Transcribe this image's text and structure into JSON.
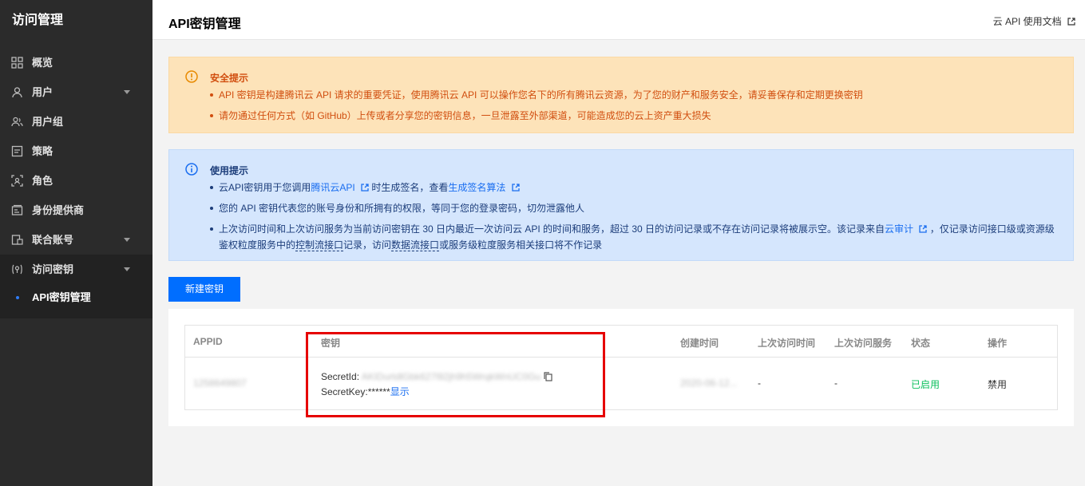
{
  "sidebar": {
    "title": "访问管理",
    "items": [
      {
        "label": "概览",
        "icon": "grid-icon"
      },
      {
        "label": "用户",
        "icon": "user-icon"
      },
      {
        "label": "用户组",
        "icon": "user-group-icon"
      },
      {
        "label": "策略",
        "icon": "policy-icon"
      },
      {
        "label": "角色",
        "icon": "role-icon"
      },
      {
        "label": "身份提供商",
        "icon": "idp-icon"
      },
      {
        "label": "联合账号",
        "icon": "federation-icon"
      },
      {
        "label": "访问密钥",
        "icon": "key-icon"
      }
    ],
    "sub_item": "API密钥管理"
  },
  "header": {
    "title": "API密钥管理",
    "doc_link": "云 API 使用文档"
  },
  "warning": {
    "title": "安全提示",
    "items": [
      "API 密钥是构建腾讯云 API 请求的重要凭证，使用腾讯云 API 可以操作您名下的所有腾讯云资源，为了您的财产和服务安全，请妥善保存和定期更换密钥",
      "请勿通过任何方式（如 GitHub）上传或者分享您的密钥信息，一旦泄露至外部渠道，可能造成您的云上资产重大损失"
    ]
  },
  "info": {
    "title": "使用提示",
    "item1": {
      "a": "云API密钥用于您调用",
      "link1": "腾讯云API",
      "b": "时生成签名，查看",
      "link2": "生成签名算法"
    },
    "item2": "您的 API 密钥代表您的账号身份和所拥有的权限，等同于您的登录密码，切勿泄露他人",
    "item3": {
      "a": "上次访问时间和上次访问服务为当前访问密钥在 30 日内最近一次访问云 API 的时间和服务，超过 30 日的访问记录或不存在访问记录将被展示空。该记录来自",
      "link": "云审计",
      "b": "，仅记录访问接口级或资源级鉴权粒度服务中的",
      "u1": "控制流接口",
      "c": "记录，访问",
      "u2": "数据流接口",
      "d": "或服务级粒度服务相关接口将不作记录"
    }
  },
  "create_button": "新建密钥",
  "table": {
    "headers": [
      "APPID",
      "密钥",
      "创建时间",
      "上次访问时间",
      "上次访问服务",
      "状态",
      "操作"
    ],
    "row": {
      "appid": "1258649807",
      "secret_id_label": "SecretId:",
      "secret_id": "AKIDurtdlGbk627l92jh9h5WrqkWnUC0Gu",
      "secret_key_label": "SecretKey:******",
      "show": "显示",
      "created": "2020-06-12...",
      "last_time": "-",
      "last_service": "-",
      "status": "已启用",
      "action": "禁用"
    }
  },
  "colors": {
    "primary": "#006eff",
    "warn_bg": "#fde3b9",
    "info_bg": "#d5e6fd",
    "highlight": "#e60000",
    "enabled": "#0abf5b"
  }
}
